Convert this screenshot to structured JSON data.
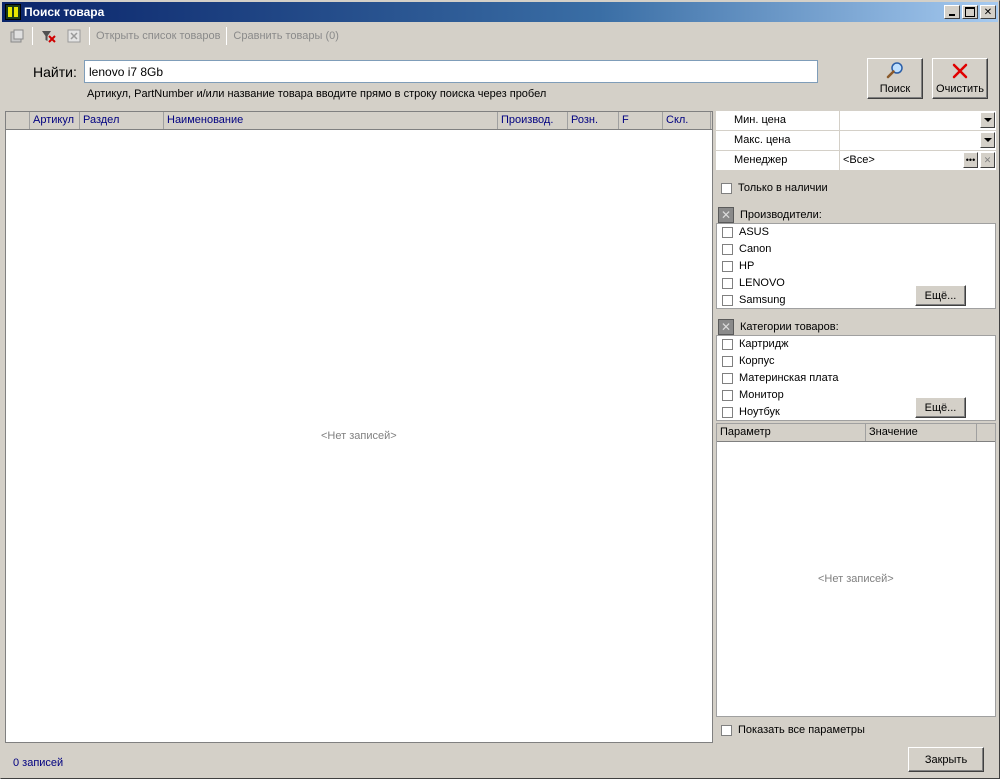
{
  "window": {
    "title": "Поиск товара"
  },
  "toolbar": {
    "open_list_label": "Открыть список товаров",
    "compare_label": "Сравнить товары (0)"
  },
  "search": {
    "label": "Найти:",
    "value": "lenovo i7 8Gb",
    "hint": "Артикул, PartNumber и/или название товара вводите прямо в строку поиска через пробел",
    "search_button": "Поиск",
    "clear_button": "Очистить"
  },
  "results": {
    "columns": [
      "Артикул",
      "Раздел",
      "Наименование",
      "Производ.",
      "Розн.",
      "F",
      "Скл."
    ],
    "empty_text": "<Нет записей>",
    "status": "0 записей"
  },
  "filters": {
    "min_price_label": "Мин. цена",
    "min_price_value": "",
    "max_price_label": "Макс. цена",
    "max_price_value": "",
    "manager_label": "Менеджер",
    "manager_value": "<Все>",
    "in_stock_label": "Только в наличии",
    "manufacturers_label": "Производители:",
    "manufacturers": [
      "ASUS",
      "Canon",
      "HP",
      "LENOVO",
      "Samsung"
    ],
    "categories_label": "Категории товаров:",
    "categories": [
      "Картридж",
      "Корпус",
      "Материнская плата",
      "Монитор",
      "Ноутбук"
    ],
    "more_label": "Ещё..."
  },
  "params": {
    "columns": [
      "Параметр",
      "Значение"
    ],
    "empty_text": "<Нет записей>",
    "show_all_label": "Показать все параметры"
  },
  "footer": {
    "close_button": "Закрыть"
  }
}
